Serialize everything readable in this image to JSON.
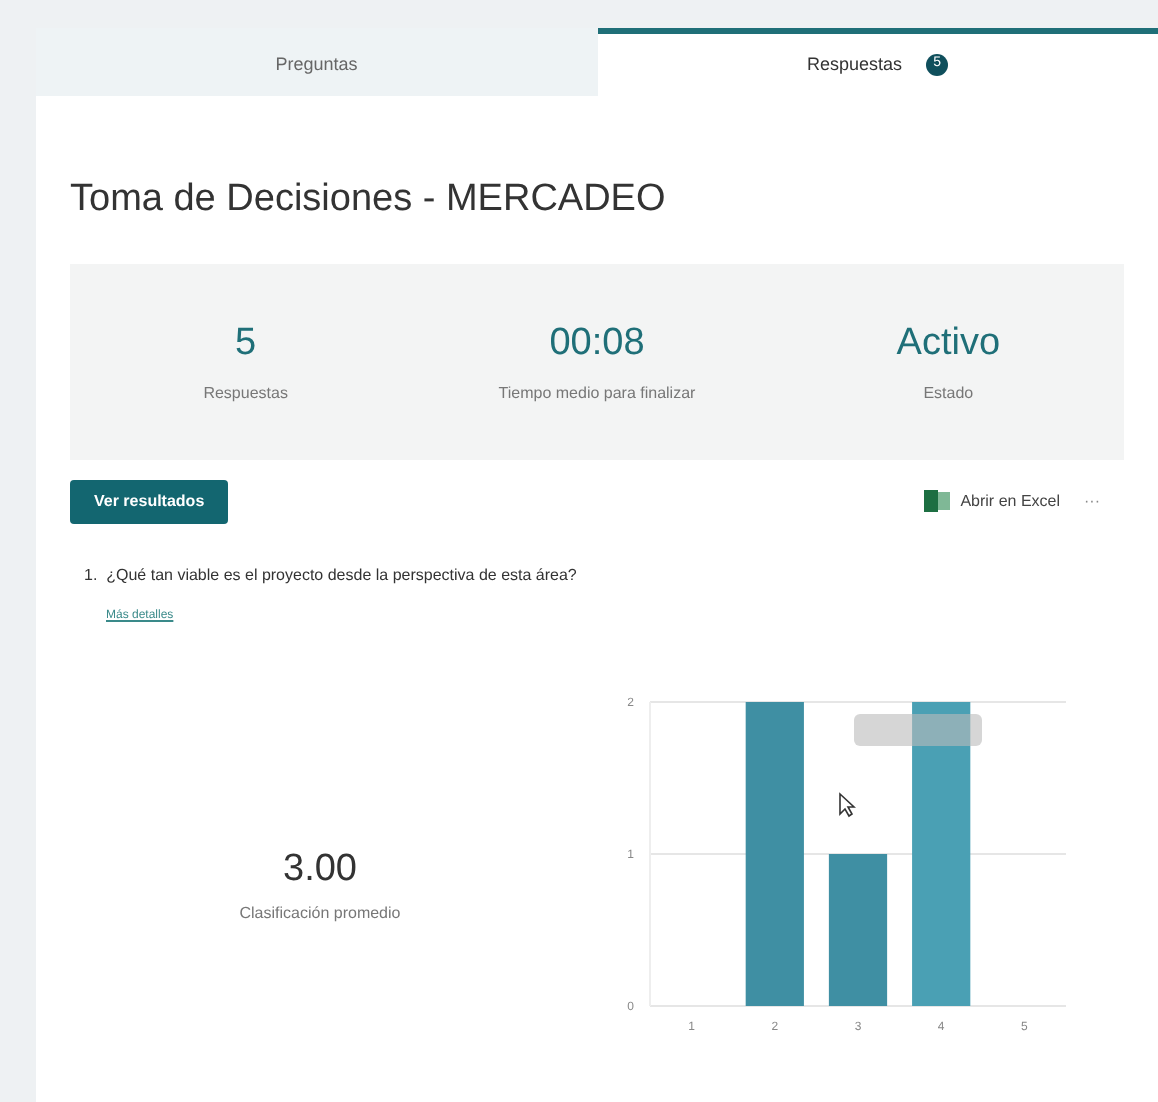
{
  "tabs": [
    {
      "label": "Preguntas",
      "selected": false
    },
    {
      "label": "Respuestas",
      "selected": true,
      "badge": "5"
    }
  ],
  "title": "Toma de Decisiones - MERCADEO",
  "stats": [
    {
      "value": "5",
      "label": "Respuestas"
    },
    {
      "value": "00:08",
      "label": "Tiempo medio para finalizar"
    },
    {
      "value": "Activo",
      "label": "Estado"
    }
  ],
  "primary_button": "Ver resultados",
  "excel_link": "Abrir en Excel",
  "more_button": "···",
  "question": {
    "text": "1.  ¿Qué tan viable es el proyecto desde la perspectiva de esta área?",
    "details_link": "Más detalles",
    "average": "3.00",
    "average_label": "Clasificación promedio",
    "chart_data": {
      "type": "bar",
      "categories": [
        "1",
        "2",
        "3",
        "4",
        "5"
      ],
      "values": [
        0,
        2,
        1,
        2,
        0
      ],
      "ylim": [
        0,
        2
      ],
      "yticks": [
        0,
        1,
        2
      ]
    }
  }
}
